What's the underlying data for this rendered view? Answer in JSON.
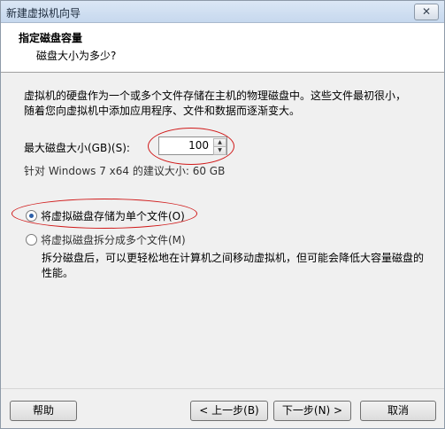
{
  "window": {
    "title": "新建虚拟机向导",
    "close_label": "✕"
  },
  "header": {
    "title": "指定磁盘容量",
    "subtitle": "磁盘大小为多少?"
  },
  "content": {
    "description": "虚拟机的硬盘作为一个或多个文件存储在主机的物理磁盘中。这些文件最初很小，随着您向虚拟机中添加应用程序、文件和数据而逐渐变大。",
    "max_size_label": "最大磁盘大小(GB)(S):",
    "max_size_value": "100",
    "recommended_hint": "针对 Windows 7 x64 的建议大小: 60 GB",
    "option_single": "将虚拟磁盘存储为单个文件(O)",
    "option_multiple": "将虚拟磁盘拆分成多个文件(M)",
    "multiple_description": "拆分磁盘后，可以更轻松地在计算机之间移动虚拟机，但可能会降低大容量磁盘的性能。",
    "selected_option": "single"
  },
  "footer": {
    "help": "帮助",
    "back": "< 上一步(B)",
    "next": "下一步(N) >",
    "cancel": "取消"
  },
  "colors": {
    "annotation": "#d01a1a",
    "radio_dot": "#2c5fa8"
  }
}
